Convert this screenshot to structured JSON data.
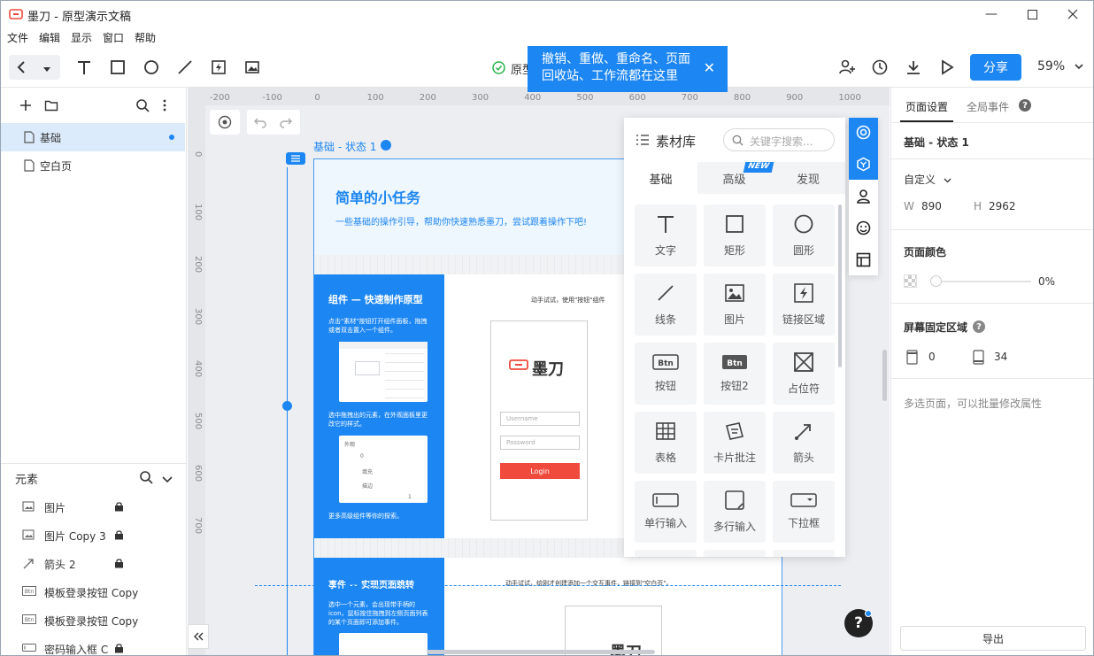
{
  "window": {
    "title": "墨刀 - 原型演示文稿"
  },
  "menu": [
    "文件",
    "编辑",
    "显示",
    "窗口",
    "帮助"
  ],
  "toolbar": {
    "status_text": "原型",
    "share_label": "分享",
    "zoom": "59%"
  },
  "tooltip": {
    "line1": "撤销、重做、重命名、页面",
    "line2": "回收站、工作流都在这里"
  },
  "pages": [
    {
      "name": "基础"
    },
    {
      "name": "空白页"
    }
  ],
  "elements": {
    "title": "元素",
    "items": [
      {
        "name": "图片",
        "icon": "image-icon",
        "locked": true
      },
      {
        "name": "图片 Copy 3",
        "icon": "image-icon",
        "locked": true
      },
      {
        "name": "箭头 2",
        "icon": "arrow-icon",
        "locked": true
      },
      {
        "name": "模板登录按钮 Copy",
        "icon": "btn-icon",
        "locked": false
      },
      {
        "name": "模板登录按钮 Copy",
        "icon": "btn-icon",
        "locked": false
      },
      {
        "name": "密码输入框 C",
        "icon": "input-icon",
        "locked": true
      }
    ]
  },
  "ruler": {
    "h": [
      "-200",
      "-100",
      "0",
      "100",
      "200",
      "300",
      "400",
      "500",
      "600",
      "700",
      "800",
      "900",
      "1000"
    ],
    "v": [
      "0",
      "100",
      "200",
      "300",
      "400",
      "500",
      "600",
      "700"
    ]
  },
  "artboard": {
    "label": "基础 - 状态 1",
    "title": "简单的小任务",
    "subtitle": "一些基础的操作引导，帮助你快速熟悉墨刀，尝试跟着操作下吧!",
    "sec1_title": "组件 — 快速制作原型",
    "sec1_step1": "点击\"素材\"按钮打开组件面板，拖拽或者双击置入一个组件。",
    "sec1_step2": "选中拖拽出的元素，在外观面板里更改它的样式。",
    "sec1_step3": "更多高级组件等你的探索。",
    "sec1_try": "动手试试，使用\"按钮\"组件",
    "sec1_mini_title": "外观",
    "sec1_mini_opt1": "0",
    "sec1_mini_opt2": "填充",
    "sec1_mini_opt3": "描边",
    "sec1_mini_num": "1",
    "phone_brand": "墨刀",
    "username_ph": "Username",
    "password_ph": "Password",
    "login_label": "Login",
    "sec2_title": "事件 — 实现页面跳转",
    "sec2_step1": "选中一个元素，会出现带手柄的icon，鼠标按住拖拽到左侧页面列表的某个页面即可添加事件。",
    "sec2_try": "动手试试，给刚才创建添加一个交互事件，链接到\"空白页\"。"
  },
  "library": {
    "title": "素材库",
    "search_placeholder": "关键字搜索...",
    "tabs": [
      "基础",
      "高级",
      "发现"
    ],
    "new_badge": "NEW",
    "items": [
      "文字",
      "矩形",
      "圆形",
      "线条",
      "图片",
      "链接区域",
      "按钮",
      "按钮2",
      "占位符",
      "表格",
      "卡片批注",
      "箭头",
      "单行输入",
      "多行输入",
      "下拉框"
    ],
    "btn_icon_text": "Btn"
  },
  "right": {
    "tabs": [
      "页面设置",
      "全局事件"
    ],
    "page_name": "基础 - 状态 1",
    "size_preset": "自定义",
    "w_label": "W",
    "w_value": "890",
    "h_label": "H",
    "h_value": "2962",
    "color_label": "页面颜色",
    "opacity": "0%",
    "fixed_label": "屏幕固定区域",
    "fixed_top": "0",
    "fixed_bottom": "34",
    "multi_hint": "多选页面，可以批量修改属性",
    "export_label": "导出"
  },
  "help_label": "?",
  "colors": {
    "accent": "#1c86f2",
    "red": "#f04a3c"
  }
}
